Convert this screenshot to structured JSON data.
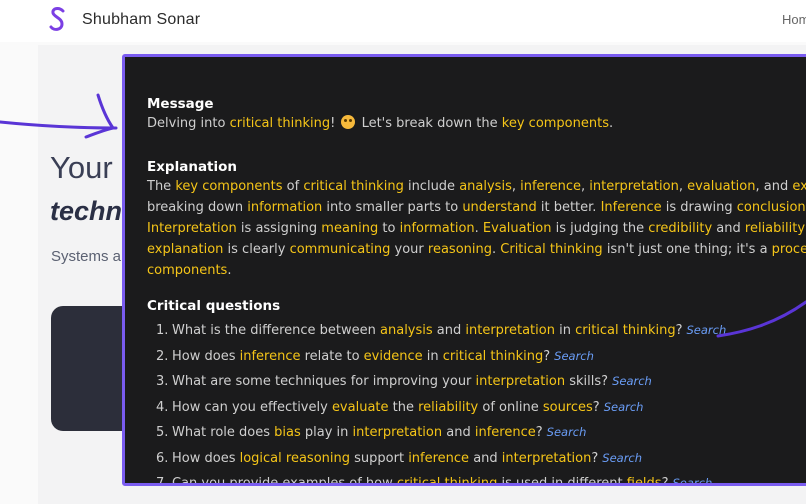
{
  "site": {
    "name": "Shubham Sonar",
    "nav_home": "Hom"
  },
  "hero": {
    "line1": "Your",
    "line2": "techn",
    "subtitle": "Systems a"
  },
  "popup": {
    "message": {
      "title": "Message",
      "segments": [
        {
          "t": "Delving into ",
          "k": false
        },
        {
          "t": "critical thinking",
          "k": true
        },
        {
          "t": "! ",
          "k": false
        },
        {
          "emoji": "thinking-face"
        },
        {
          "t": " Let's break down the ",
          "k": false
        },
        {
          "t": "key components",
          "k": true
        },
        {
          "t": ".",
          "k": false
        }
      ]
    },
    "explanation": {
      "title": "Explanation",
      "lines": [
        [
          {
            "t": "The ",
            "k": false
          },
          {
            "t": "key components",
            "k": true
          },
          {
            "t": " of ",
            "k": false
          },
          {
            "t": "critical thinking",
            "k": true
          },
          {
            "t": " include ",
            "k": false
          },
          {
            "t": "analysis",
            "k": true
          },
          {
            "t": ", ",
            "k": false
          },
          {
            "t": "inference",
            "k": true
          },
          {
            "t": ", ",
            "k": false
          },
          {
            "t": "interpretation",
            "k": true
          },
          {
            "t": ", ",
            "k": false
          },
          {
            "t": "evaluation",
            "k": true
          },
          {
            "t": ", and ",
            "k": false
          },
          {
            "t": "exp",
            "k": true
          }
        ],
        [
          {
            "t": "breaking down ",
            "k": false
          },
          {
            "t": "information",
            "k": true
          },
          {
            "t": " into smaller parts to ",
            "k": false
          },
          {
            "t": "understand",
            "k": true
          },
          {
            "t": " it better. ",
            "k": false
          },
          {
            "t": "Inference",
            "k": true
          },
          {
            "t": " is drawing ",
            "k": false
          },
          {
            "t": "conclusions",
            "k": true
          },
          {
            "t": " b",
            "k": false
          }
        ],
        [
          {
            "t": "Interpretation",
            "k": true
          },
          {
            "t": " is assigning ",
            "k": false
          },
          {
            "t": "meaning",
            "k": true
          },
          {
            "t": " to ",
            "k": false
          },
          {
            "t": "information",
            "k": true
          },
          {
            "t": ". ",
            "k": false
          },
          {
            "t": "Evaluation",
            "k": true
          },
          {
            "t": " is judging the ",
            "k": false
          },
          {
            "t": "credibility",
            "k": true
          },
          {
            "t": " and ",
            "k": false
          },
          {
            "t": "reliability",
            "k": true
          },
          {
            "t": " o",
            "k": false
          }
        ],
        [
          {
            "t": "explanation",
            "k": true
          },
          {
            "t": " is clearly ",
            "k": false
          },
          {
            "t": "communicating",
            "k": true
          },
          {
            "t": " your ",
            "k": false
          },
          {
            "t": "reasoning",
            "k": true
          },
          {
            "t": ". ",
            "k": false
          },
          {
            "t": "Critical thinking",
            "k": true
          },
          {
            "t": " isn't just one thing; it's a ",
            "k": false
          },
          {
            "t": "process",
            "k": true
          }
        ],
        [
          {
            "t": "components",
            "k": true
          },
          {
            "t": ".",
            "k": false
          }
        ]
      ]
    },
    "questions": {
      "title": "Critical questions",
      "search_label": "Search",
      "items": [
        [
          {
            "t": "What is the difference between ",
            "k": false
          },
          {
            "t": "analysis",
            "k": true
          },
          {
            "t": " and ",
            "k": false
          },
          {
            "t": "interpretation",
            "k": true
          },
          {
            "t": " in ",
            "k": false
          },
          {
            "t": "critical thinking",
            "k": true
          },
          {
            "t": "?",
            "k": false
          }
        ],
        [
          {
            "t": "How does ",
            "k": false
          },
          {
            "t": "inference",
            "k": true
          },
          {
            "t": " relate to ",
            "k": false
          },
          {
            "t": "evidence",
            "k": true
          },
          {
            "t": " in ",
            "k": false
          },
          {
            "t": "critical thinking",
            "k": true
          },
          {
            "t": "?",
            "k": false
          }
        ],
        [
          {
            "t": "What are some techniques for improving your ",
            "k": false
          },
          {
            "t": "interpretation",
            "k": true
          },
          {
            "t": " skills?",
            "k": false
          }
        ],
        [
          {
            "t": "How can you effectively ",
            "k": false
          },
          {
            "t": "evaluate",
            "k": true
          },
          {
            "t": " the ",
            "k": false
          },
          {
            "t": "reliability",
            "k": true
          },
          {
            "t": " of online ",
            "k": false
          },
          {
            "t": "sources",
            "k": true
          },
          {
            "t": "?",
            "k": false
          }
        ],
        [
          {
            "t": "What role does ",
            "k": false
          },
          {
            "t": "bias",
            "k": true
          },
          {
            "t": " play in ",
            "k": false
          },
          {
            "t": "interpretation",
            "k": true
          },
          {
            "t": " and ",
            "k": false
          },
          {
            "t": "inference",
            "k": true
          },
          {
            "t": "?",
            "k": false
          }
        ],
        [
          {
            "t": "How does ",
            "k": false
          },
          {
            "t": "logical reasoning",
            "k": true
          },
          {
            "t": " support ",
            "k": false
          },
          {
            "t": "inference",
            "k": true
          },
          {
            "t": " and ",
            "k": false
          },
          {
            "t": "interpretation",
            "k": true
          },
          {
            "t": "?",
            "k": false
          }
        ],
        [
          {
            "t": "Can you provide examples of how ",
            "k": false
          },
          {
            "t": "critical thinking",
            "k": true
          },
          {
            "t": " is used in different ",
            "k": false
          },
          {
            "t": "fields",
            "k": true
          },
          {
            "t": "?",
            "k": false
          }
        ]
      ]
    }
  },
  "colors": {
    "keyword": "#f5c518",
    "popup_border": "#7a5cf0",
    "popup_bg": "#1b1b1c",
    "search_link": "#6a9df6",
    "annotation_arrow": "#5a35d6"
  }
}
